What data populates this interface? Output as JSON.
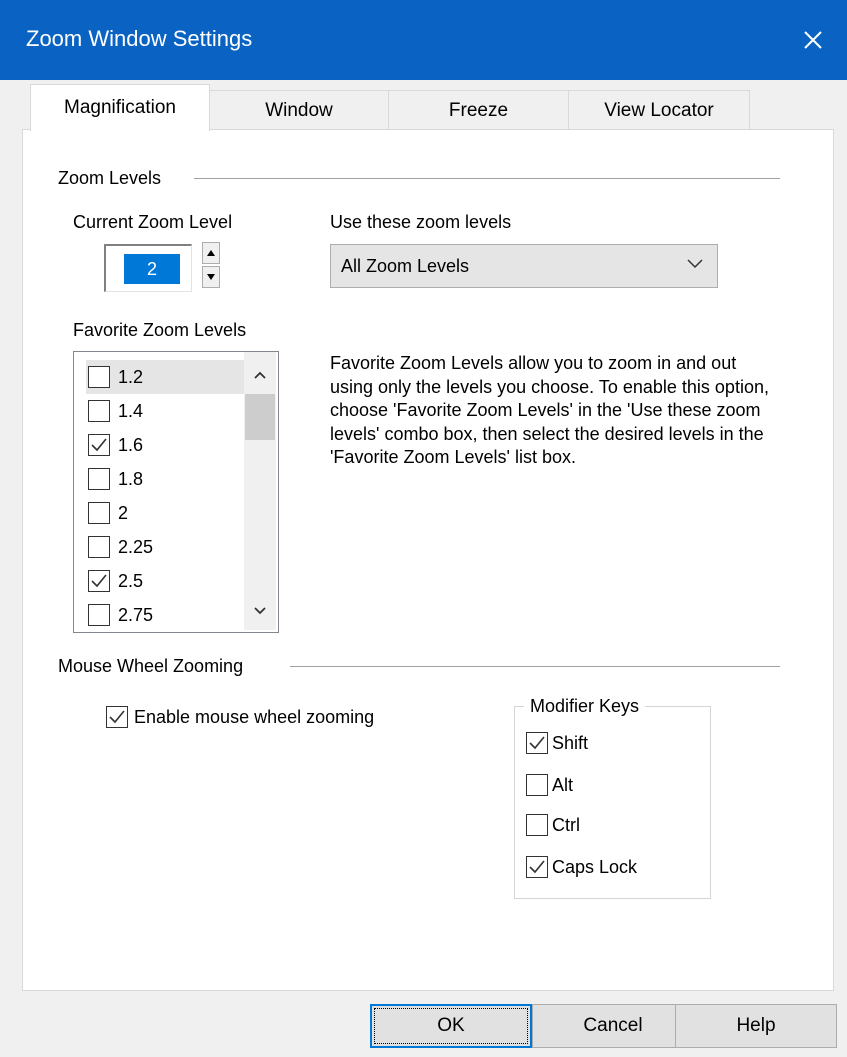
{
  "window": {
    "title": "Zoom Window Settings"
  },
  "tabs": [
    {
      "label": "Magnification",
      "active": true
    },
    {
      "label": "Window",
      "active": false
    },
    {
      "label": "Freeze",
      "active": false
    },
    {
      "label": "View Locator",
      "active": false
    }
  ],
  "zoom_levels": {
    "group_label": "Zoom Levels",
    "current_label": "Current Zoom Level",
    "current_value": "2",
    "use_label": "Use these zoom levels",
    "use_selected": "All Zoom Levels",
    "favorites_label": "Favorite Zoom Levels",
    "favorites": [
      {
        "label": "1.2",
        "checked": false
      },
      {
        "label": "1.4",
        "checked": false
      },
      {
        "label": "1.6",
        "checked": true
      },
      {
        "label": "1.8",
        "checked": false
      },
      {
        "label": "2",
        "checked": false
      },
      {
        "label": "2.25",
        "checked": false
      },
      {
        "label": "2.5",
        "checked": true
      },
      {
        "label": "2.75",
        "checked": false
      }
    ],
    "description": "Favorite Zoom Levels allow you to zoom in and out using only the levels you choose. To enable this option, choose 'Favorite Zoom Levels' in the 'Use these zoom levels' combo box, then select the desired levels in the 'Favorite Zoom Levels' list box."
  },
  "mouse_wheel": {
    "group_label": "Mouse Wheel Zooming",
    "enable_label": "Enable mouse wheel zooming",
    "enable_checked": true,
    "modifier_label": "Modifier Keys",
    "modifiers": [
      {
        "label": "Shift",
        "checked": true
      },
      {
        "label": "Alt",
        "checked": false
      },
      {
        "label": "Ctrl",
        "checked": false
      },
      {
        "label": "Caps Lock",
        "checked": true
      }
    ]
  },
  "buttons": {
    "ok": "OK",
    "cancel": "Cancel",
    "help": "Help"
  }
}
